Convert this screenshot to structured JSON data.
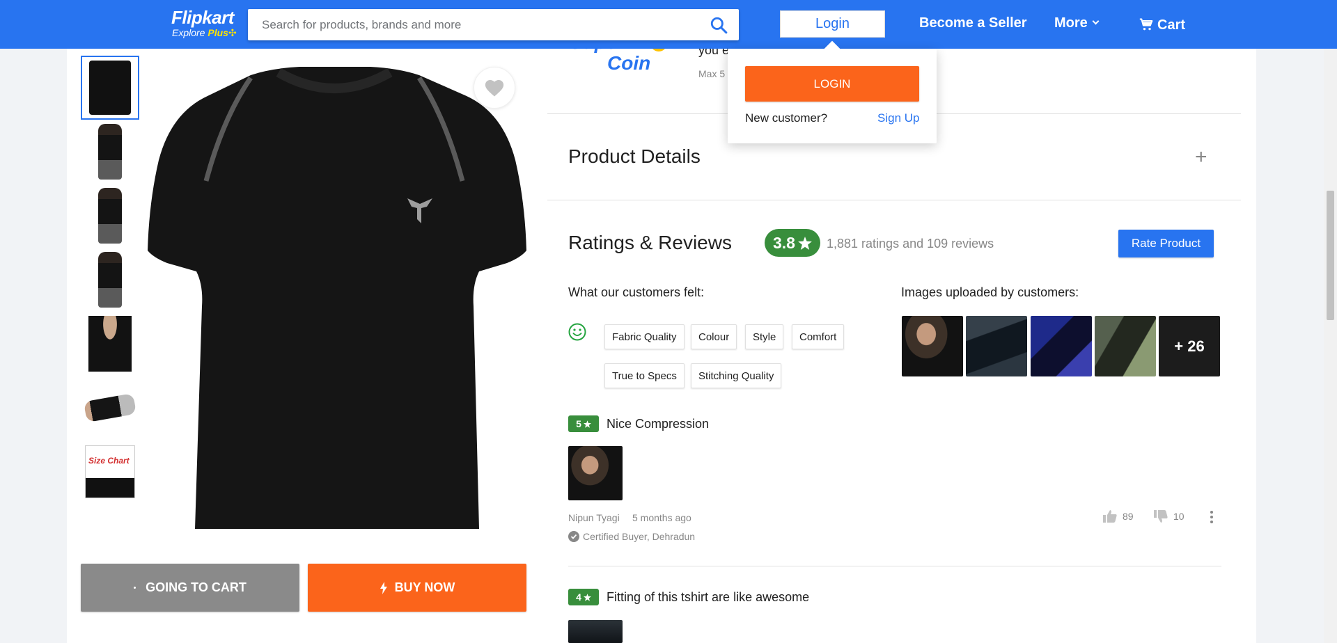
{
  "header": {
    "brand": "Flipkart",
    "tagline": "Explore",
    "tagline_plus": "Plus",
    "search_placeholder": "Search for products, brands and more",
    "login_label": "Login",
    "seller_label": "Become a Seller",
    "more_label": "More",
    "cart_label": "Cart"
  },
  "login_dropdown": {
    "login_button": "LOGIN",
    "new_customer": "New customer?",
    "sign_up": "Sign Up"
  },
  "product": {
    "thumbnails": [
      "front",
      "back-model",
      "side-model",
      "front-model",
      "neck-closeup",
      "workout-model",
      "size-chart"
    ],
    "size_chart_text": "Size Chart",
    "cart_button": "GOING TO CART",
    "buy_button": "BUY NOW"
  },
  "supercoin": {
    "text_partial": "you e",
    "sub_partial": "Max 5",
    "logo_text_1": "Super",
    "logo_text_2": "Coin"
  },
  "product_details": {
    "title": "Product Details",
    "expand_symbol": "+"
  },
  "ratings": {
    "title": "Ratings & Reviews",
    "score": "3.8",
    "count_text": "1,881 ratings and 109 reviews",
    "rate_button": "Rate Product",
    "felt_title": "What our customers felt:",
    "chips": [
      "Fabric Quality",
      "Colour",
      "Style",
      "Comfort",
      "True to Specs",
      "Stitching Quality"
    ],
    "uploaded_title": "Images uploaded by customers:",
    "more_images": "+ 26"
  },
  "reviews": [
    {
      "stars": "5",
      "title": "Nice Compression",
      "author": "Nipun Tyagi",
      "time": "5 months ago",
      "certified": "Certified Buyer, Dehradun",
      "likes": "89",
      "dislikes": "10"
    },
    {
      "stars": "4",
      "title": "Fitting of this tshirt are like awesome"
    }
  ],
  "colors": {
    "brand_blue": "#2874f0",
    "accent_orange": "#fb641b",
    "rating_green": "#388e3c",
    "cart_gray": "#8a8a8a"
  }
}
